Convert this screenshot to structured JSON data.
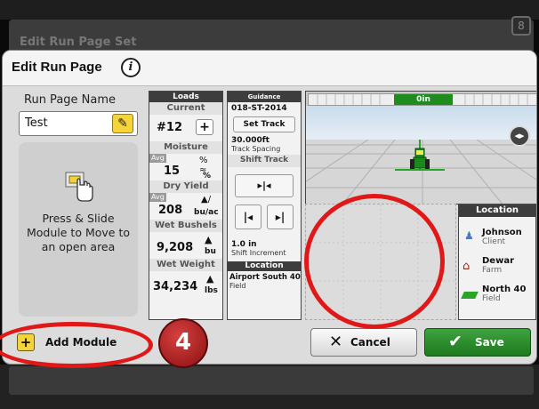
{
  "background": {
    "title": "Edit Run Page Set",
    "corner_glyph": "8"
  },
  "dialog": {
    "title": "Edit Run Page",
    "info_icon": "i"
  },
  "left_panel": {
    "run_page_name_label": "Run Page Name",
    "run_page_name_value": "Test",
    "drag_hint": "Press & Slide Module to Move to an open area"
  },
  "loads": {
    "header": "Loads",
    "current_label": "Current",
    "current_value": "#12",
    "plus": "+",
    "moisture_label": "Moisture",
    "avg": "Avg",
    "moisture_value": "15",
    "moisture_unit": "%",
    "dry_yield_label": "Dry Yield",
    "dry_yield_value": "208",
    "dry_yield_unit": "bu/ac",
    "wet_bushels_label": "Wet Bushels",
    "wet_bushels_value": "9,208",
    "wet_bushels_unit": "bu",
    "wet_weight_label": "Wet Weight",
    "wet_weight_value": "34,234",
    "wet_weight_unit": "lbs"
  },
  "guidance": {
    "header": "Guidance",
    "track_name": "018-ST-2014",
    "set_track": "Set Track",
    "spacing_value": "30.000ft",
    "spacing_label": "Track Spacing",
    "shift_track": "Shift Track",
    "shift_value": "1.0 in",
    "shift_label": "Shift Increment",
    "location_header": "Location",
    "location_field": "Airport South 40",
    "location_kind": "Field"
  },
  "map": {
    "offset": "0in"
  },
  "location": {
    "header": "Location",
    "items": [
      {
        "name": "Johnson",
        "kind": "Client"
      },
      {
        "name": "Dewar",
        "kind": "Farm"
      },
      {
        "name": "North 40",
        "kind": "Field"
      }
    ]
  },
  "footer": {
    "add_module": "Add Module",
    "add_icon": "+",
    "cancel": "Cancel",
    "save": "Save"
  },
  "annotation": {
    "step_number": "4"
  },
  "colors": {
    "accent_yellow": "#f5d33a",
    "save_green": "#1d7a1d",
    "annotation_red": "#e01818",
    "header_dark": "#3d3d3d"
  }
}
